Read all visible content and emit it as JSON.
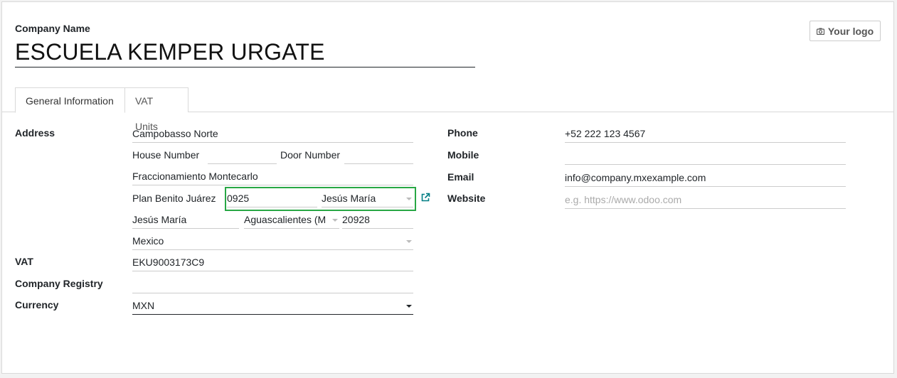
{
  "header": {
    "company_label": "Company Name",
    "company_name": "ESCUELA KEMPER URGATE",
    "logo_button": "Your logo"
  },
  "tabs": [
    {
      "label": "General Information",
      "active": true
    },
    {
      "label": "VAT Units",
      "active": false
    }
  ],
  "left": {
    "address_label": "Address",
    "street": "Campobasso Norte",
    "house_number_label": "House Number",
    "house_number": "",
    "door_number_label": "Door Number",
    "door_number": "",
    "street2": "Fraccionamiento Montecarlo",
    "colony": "Plan Benito Juárez",
    "zip_ext": "0925",
    "municipality": "Jesús María",
    "city": "Jesús María",
    "state": "Aguascalientes (M",
    "zip": "20928",
    "country": "Mexico",
    "vat_label": "VAT",
    "vat": "EKU9003173C9",
    "registry_label": "Company Registry",
    "registry": "",
    "currency_label": "Currency",
    "currency": "MXN"
  },
  "right": {
    "phone_label": "Phone",
    "phone": "+52 222 123 4567",
    "mobile_label": "Mobile",
    "mobile": "",
    "email_label": "Email",
    "email": "info@company.mxexample.com",
    "website_label": "Website",
    "website_placeholder": "e.g. https://www.odoo.com"
  },
  "colors": {
    "highlight": "#28a745",
    "link_icon": "#017e84"
  },
  "icons": {
    "logo": "camera-icon",
    "external": "external-link-icon"
  }
}
